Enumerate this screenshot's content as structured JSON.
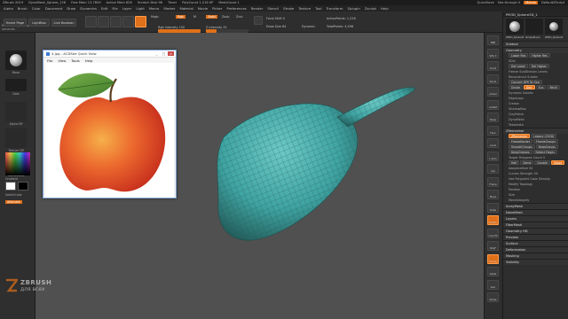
{
  "window": {
    "title": "ZBrush 2019",
    "doc_name": "DynaMesh_Sphere_128",
    "stats": [
      "Free Mem 13.7859",
      "Active Mem 626",
      "Scratch Disk 98",
      "Timer",
      "PolyCount 1.216 KP",
      "MeshCount 1"
    ],
    "quicksave_label": "QuickSave",
    "seethrough_label": "See-through 0",
    "menus_label": "Menus",
    "script_label": "DefaultZScript"
  },
  "menubar": [
    "Alpha",
    "Brush",
    "Color",
    "Document",
    "Draw",
    "Dynamics",
    "Edit",
    "File",
    "Layer",
    "Light",
    "Macro",
    "Marker",
    "Material",
    "Movie",
    "Picker",
    "Preferences",
    "Render",
    "Stencil",
    "Stroke",
    "Texture",
    "Tool",
    "Transform",
    "Zplugin",
    "Zscript",
    "Help"
  ],
  "status": "Remeshing completed in 1 seconds",
  "toolbar": {
    "home_page": "Home Page",
    "lightbox": "LightBox",
    "live_boolean": "Live Boolean",
    "mrgb": "Mrgb",
    "rgb": "Rgb",
    "m": "M",
    "zadd": "Zadd",
    "zsub": "Zsub",
    "zcut": "Zcut",
    "rgb_intensity": "Rgb Intensity 100",
    "z_intensity": "Z Intensity 25",
    "focal_shift": "Focal Shift 0",
    "draw_size": "Draw Size 64",
    "dynamic": "Dynamic",
    "active_points": "ActivePoints: 1,216",
    "total_points": "TotalPoints: 4,598",
    "rgb_intensity_value": 1.0,
    "z_intensity_value": 0.25
  },
  "left_panel": {
    "items": [
      "Move",
      "Dots",
      "Alpha Off",
      "Texture Off",
      "SkinShade4"
    ],
    "gradient_label": "Gradient",
    "switch_color_label": "SwitchColor",
    "alternate_label": "Alternate"
  },
  "quickview": {
    "title": "4.jpg - ACDSee Quick View",
    "menu": [
      "File",
      "View",
      "Tools",
      "Help"
    ],
    "minimize": "_",
    "maximize": "□",
    "close": "×"
  },
  "right_shelf": [
    "BPR",
    "SPix 3",
    "Scroll",
    "Zoom",
    "Actual",
    "AAHalf",
    "Persp",
    "Floor",
    "Local",
    "L.Sym",
    "Xyz",
    "Frame",
    "Move",
    "Scale",
    "Rotate",
    "Line Fill",
    "PolyF",
    "Transp",
    "Ghost",
    "Solo",
    "Xpose"
  ],
  "right_panel": {
    "tool_name": "PM3D_Sphere3D_1",
    "thumb_labels": [
      "PM3D_Sphere3D",
      "SimpleBrush",
      "PM3D_Sphere3D_1"
    ],
    "sections": [
      {
        "type": "sect",
        "text": "Subtool"
      },
      {
        "type": "sect",
        "text": "Geometry"
      },
      {
        "type": "btns",
        "items": [
          "Lower Res",
          "Higher Res"
        ],
        "on": []
      },
      {
        "type": "row",
        "text": "SDiv"
      },
      {
        "type": "btns",
        "items": [
          "Del Lower",
          "Del Higher"
        ],
        "on": []
      },
      {
        "type": "row",
        "text": "Freeze SubDivision Levels"
      },
      {
        "type": "row",
        "text": "Reconstruct Subdiv"
      },
      {
        "type": "btns",
        "items": [
          "Convert BPR To Geo"
        ],
        "on": []
      },
      {
        "type": "btns",
        "items": [
          "Divide",
          "Smt",
          "Suv",
          "ReUV"
        ],
        "on": [
          "Smt"
        ]
      },
      {
        "type": "row",
        "text": "Dynamic Subdiv"
      },
      {
        "type": "row",
        "text": "EdgeLoop"
      },
      {
        "type": "row",
        "text": "Crease"
      },
      {
        "type": "row",
        "text": "ShadowBox"
      },
      {
        "type": "row",
        "text": "ClayPolish"
      },
      {
        "type": "row",
        "text": "DynaMesh"
      },
      {
        "type": "row",
        "text": "Tessimate"
      },
      {
        "type": "sect",
        "text": "ZRemesher"
      },
      {
        "type": "btns",
        "items": [
          "ZRemesher",
          "Legacy (2018)"
        ],
        "on": [
          "ZRemesher"
        ]
      },
      {
        "type": "btns",
        "items": [
          "FreezeBorder",
          "FreezeGroups"
        ],
        "on": []
      },
      {
        "type": "btns",
        "items": [
          "SmoothGroups",
          "KeepGroups"
        ],
        "on": []
      },
      {
        "type": "btns",
        "items": [
          "KeepCreases",
          "Detect Edges"
        ],
        "on": []
      },
      {
        "type": "row",
        "text": "Target Polygons Count 5"
      },
      {
        "type": "btns",
        "items": [
          "Half",
          "Same",
          "Double",
          "Adapt"
        ],
        "on": [
          "Adapt"
        ]
      },
      {
        "type": "row",
        "text": "AdaptiveSize 50"
      },
      {
        "type": "row",
        "text": "Curves Strength 50"
      },
      {
        "type": "row",
        "text": "Use Polypaint   Color Density"
      },
      {
        "type": "row",
        "text": "Modify Topology"
      },
      {
        "type": "row",
        "text": "Position"
      },
      {
        "type": "row",
        "text": "Size"
      },
      {
        "type": "row",
        "text": "MeshIntegrity"
      },
      {
        "type": "sect",
        "text": "ArrayMesh"
      },
      {
        "type": "sect",
        "text": "NanoMesh"
      },
      {
        "type": "sect",
        "text": "Layers"
      },
      {
        "type": "sect",
        "text": "FiberMesh"
      },
      {
        "type": "sect",
        "text": "Geometry HD"
      },
      {
        "type": "sect",
        "text": "Preview"
      },
      {
        "type": "sect",
        "text": "Surface"
      },
      {
        "type": "sect",
        "text": "Deformation"
      },
      {
        "type": "sect",
        "text": "Masking"
      },
      {
        "type": "sect",
        "text": "Visibility"
      }
    ]
  },
  "watermark": {
    "line1": "ZBRUSH",
    "line2": "для всех"
  },
  "colors": {
    "accent": "#e0701a",
    "mesh": "#3fa3a1",
    "apple_red": "#e8452a",
    "leaf": "#5f9a3c"
  }
}
